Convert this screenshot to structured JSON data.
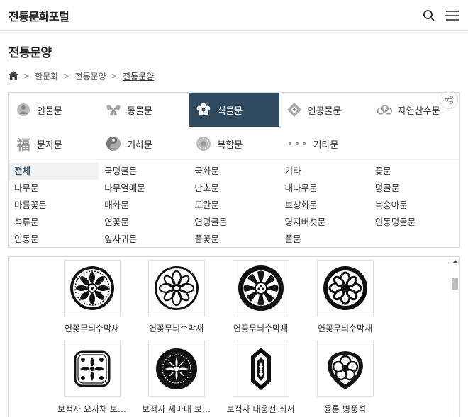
{
  "site": {
    "title": "전통문화포털"
  },
  "page": {
    "title": "전통문양"
  },
  "breadcrumb": [
    "한문화",
    "전통문양",
    "전통문양"
  ],
  "categories": [
    {
      "label": "인물문",
      "icon": "person-pattern-icon",
      "active": false
    },
    {
      "label": "동물문",
      "icon": "butterfly-icon",
      "active": false
    },
    {
      "label": "식물문",
      "icon": "flower-icon",
      "active": true
    },
    {
      "label": "인공물문",
      "icon": "diamond-ornament-icon",
      "active": false
    },
    {
      "label": "자연산수문",
      "icon": "cloud-icon",
      "active": false
    },
    {
      "label": "문자문",
      "icon": "character-icon",
      "active": false
    },
    {
      "label": "기하문",
      "icon": "swirl-icon",
      "active": false
    },
    {
      "label": "복합문",
      "icon": "round-pattern-icon",
      "active": false
    },
    {
      "label": "기타문",
      "icon": "dots-icon",
      "active": false
    }
  ],
  "subcategories": [
    "전체",
    "국덩굴문",
    "국화문",
    "기타",
    "꽃문",
    "나무문",
    "나무열매문",
    "난초문",
    "대나무문",
    "덩굴문",
    "마름꽃문",
    "매화문",
    "모란문",
    "보상화문",
    "복숭아문",
    "석류문",
    "연꽃문",
    "연덩굴문",
    "영지버섯문",
    "인동덩굴문",
    "인동문",
    "잎사귀문",
    "풀꽃문",
    "풀문"
  ],
  "active_subcategory": "전체",
  "items": [
    {
      "caption": "연꽃무늬수막새"
    },
    {
      "caption": "연꽃무늬수막새"
    },
    {
      "caption": "연꽃무늬수막새"
    },
    {
      "caption": "연꽃무늬수막새"
    },
    {
      "caption": "보적사 요사채 보…"
    },
    {
      "caption": "보적사 세마대 보…"
    },
    {
      "caption": "보적사 대웅전 쇠서"
    },
    {
      "caption": "융릉 병풍석"
    }
  ],
  "colors": {
    "active_tab": "#2f4a5f"
  }
}
